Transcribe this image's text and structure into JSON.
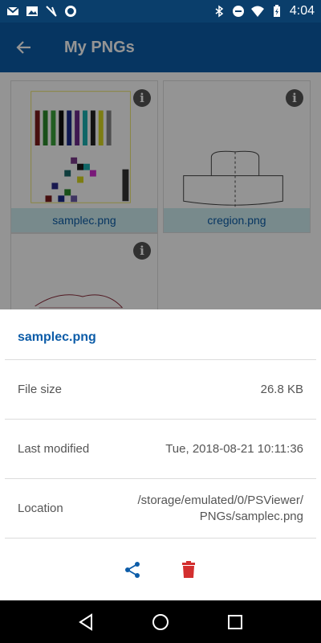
{
  "status_bar": {
    "time": "4:04",
    "left_icons": [
      "gmail-icon",
      "image-icon",
      "no-signal-icon",
      "circle-icon"
    ],
    "right_icons": [
      "bluetooth-icon",
      "do-not-disturb-icon",
      "wifi-icon",
      "battery-icon"
    ]
  },
  "app_bar": {
    "title": "My PNGs",
    "back_icon": "arrow-left-icon"
  },
  "files": [
    {
      "name": "samplec.png"
    },
    {
      "name": "cregion.png"
    },
    {
      "name": ""
    }
  ],
  "details_sheet": {
    "title": "samplec.png",
    "rows": [
      {
        "label": "File size",
        "value": "26.8 KB"
      },
      {
        "label": "Last modified",
        "value": "Tue, 2018-08-21 10:11:36"
      },
      {
        "label": "Location",
        "value_line1": "/storage/emulated/0/PSViewer/",
        "value_line2": "PNGs/samplec.png"
      }
    ],
    "actions": [
      "share-icon",
      "delete-icon"
    ]
  },
  "colors": {
    "status_bar": "#0a3e6b",
    "app_bar": "#0c5ca8",
    "accent": "#0c5ca8",
    "delete": "#d32f2f"
  },
  "nav_bar": [
    "back-triangle-icon",
    "home-circle-icon",
    "recents-square-icon"
  ]
}
